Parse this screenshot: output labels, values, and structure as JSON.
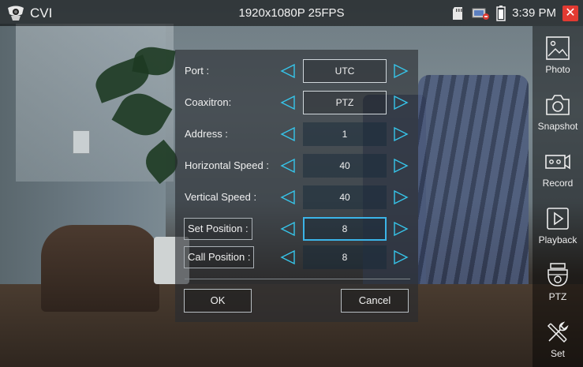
{
  "app": {
    "title": "CVI",
    "resolution": "1920x1080P 25FPS",
    "time": "3:39 PM"
  },
  "status_icons": [
    "sd-card-icon",
    "network-icon",
    "battery-icon",
    "close-icon"
  ],
  "dialog": {
    "rows": [
      {
        "label": "Port :",
        "value": "UTC",
        "boxed_label": false,
        "state": "outlined"
      },
      {
        "label": "Coaxitron:",
        "value": "PTZ",
        "boxed_label": false,
        "state": "outlined"
      },
      {
        "label": "Address :",
        "value": "1",
        "boxed_label": false,
        "state": "filled"
      },
      {
        "label": "Horizontal Speed :",
        "value": "40",
        "boxed_label": false,
        "state": "filled"
      },
      {
        "label": "Vertical Speed :",
        "value": "40",
        "boxed_label": false,
        "state": "filled"
      },
      {
        "label": "Set Position :",
        "value": "8",
        "boxed_label": true,
        "state": "selected"
      },
      {
        "label": "Call Position :",
        "value": "8",
        "boxed_label": true,
        "state": "filled"
      }
    ],
    "ok_label": "OK",
    "cancel_label": "Cancel"
  },
  "sidebar": {
    "items": [
      {
        "label": "Photo",
        "icon": "photo-icon"
      },
      {
        "label": "Snapshot",
        "icon": "camera-icon"
      },
      {
        "label": "Record",
        "icon": "record-icon"
      },
      {
        "label": "Playback",
        "icon": "playback-icon"
      },
      {
        "label": "PTZ",
        "icon": "ptz-dome-icon"
      },
      {
        "label": "Set",
        "icon": "tools-icon"
      }
    ]
  },
  "colors": {
    "accent": "#3bb4e8",
    "close": "#e23a32",
    "arrow": "#36c5ea"
  }
}
